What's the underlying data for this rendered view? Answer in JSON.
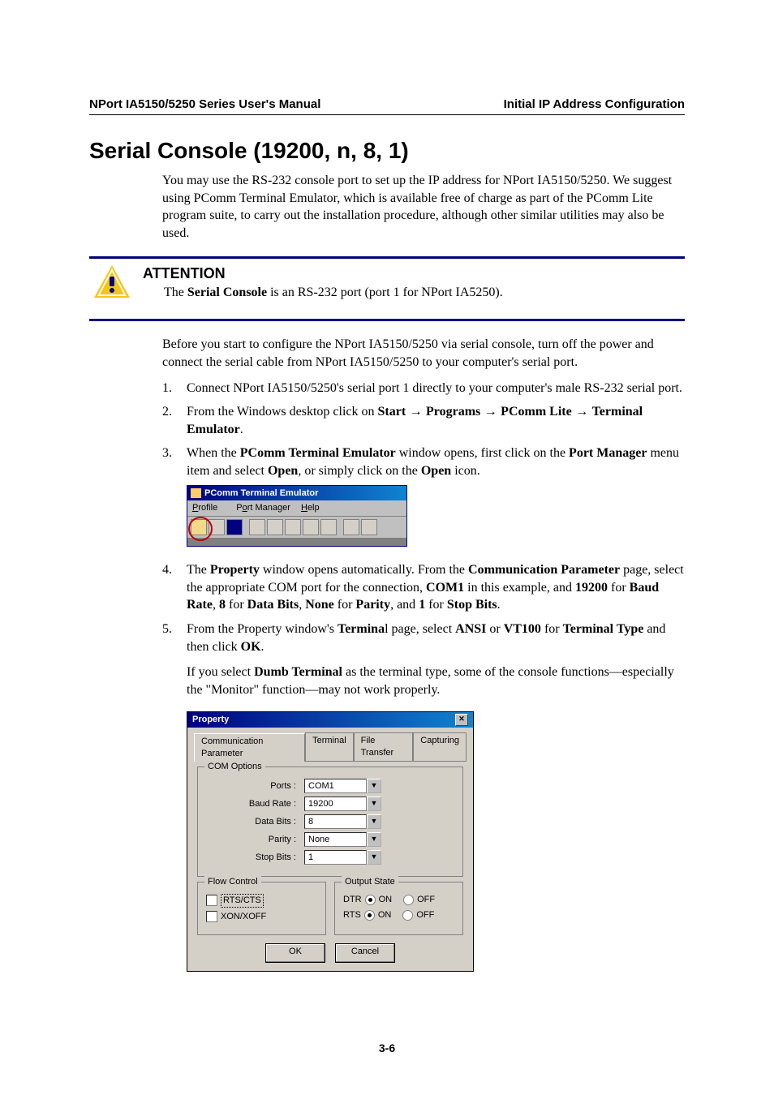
{
  "header": {
    "left": "NPort IA5150/5250 Series User's Manual",
    "right": "Initial IP Address Configuration"
  },
  "section_title": "Serial Console (19200, n, 8, 1)",
  "intro_para": "You may use the RS-232 console port to set up the IP address for NPort IA5150/5250. We suggest using PComm Terminal Emulator, which is available free of charge as part of the PComm Lite program suite, to carry out the installation procedure, although other similar utilities may also be used.",
  "attention": {
    "title": "ATTENTION",
    "text_pre": "The ",
    "text_bold": "Serial Console",
    "text_post": " is an RS-232 port (port 1 for NPort IA5250)."
  },
  "pre_list_para": "Before you start to configure the NPort IA5150/5250 via serial console, turn off the power and connect the serial cable from NPort IA5150/5250 to your computer's serial port.",
  "steps": {
    "s1": "Connect NPort IA5150/5250's serial port 1 directly to your computer's male RS-232 serial port.",
    "s2": {
      "t1": "From the Windows desktop click on ",
      "start": "Start",
      "arrow": " → ",
      "programs": "Programs",
      "pcomm": "PComm Lite",
      "terminal": "Terminal Emulator",
      "period": "."
    },
    "s3": {
      "t1": "When the ",
      "b1": "PComm Terminal Emulator",
      "t2": " window opens, first click on the ",
      "b2": "Port Manager",
      "t3": " menu item and select ",
      "b3": "Open",
      "t4": ", or simply click on the ",
      "b4": "Open",
      "t5": " icon."
    },
    "s4": {
      "t1": "The ",
      "b1": "Property",
      "t2": " window opens automatically. From the ",
      "b2": "Communication Parameter",
      "t3": " page, select the appropriate COM port for the connection, ",
      "b3": "COM1",
      "t4": " in this example, and ",
      "b4": "19200",
      "t5": " for ",
      "b5": "Baud Rate",
      "t6": ", ",
      "b6": "8",
      "t7": " for ",
      "b7": "Data Bits",
      "t8": ", ",
      "b8": "None",
      "t9": " for ",
      "b9": "Parity",
      "t10": ", and ",
      "b10": "1",
      "t11": " for ",
      "b11": "Stop Bits",
      "t12": "."
    },
    "s5": {
      "t1": "From the Property window's ",
      "b1": "Termina",
      "t1b": "l page, select ",
      "b2": "ANSI",
      "t2": " or ",
      "b3": "VT100",
      "t3": " for ",
      "b4": "Terminal Type",
      "t4": " and then click ",
      "b5": "OK",
      "t5": "."
    },
    "s5_sub": {
      "t1": "If you select ",
      "b1": "Dumb Terminal",
      "t2": " as the terminal type, some of the console functions—especially the \"Monitor\" function—may not work properly."
    }
  },
  "pcomm_screenshot": {
    "title": "PComm Terminal Emulator",
    "menu_profile": "Profile",
    "menu_portmanager": "Port Manager",
    "menu_help": "Help"
  },
  "property_dialog": {
    "title": "Property",
    "tabs": {
      "comm": "Communication Parameter",
      "terminal": "Terminal",
      "file": "File Transfer",
      "capturing": "Capturing"
    },
    "com_options_label": "COM Options",
    "ports_label": "Ports :",
    "ports_value": "COM1",
    "baud_label": "Baud Rate :",
    "baud_value": "19200",
    "databits_label": "Data Bits :",
    "databits_value": "8",
    "parity_label": "Parity :",
    "parity_value": "None",
    "stopbits_label": "Stop Bits :",
    "stopbits_value": "1",
    "flow_label": "Flow Control",
    "flow_rtscts": "RTS/CTS",
    "flow_xonxoff": "XON/XOFF",
    "output_label": "Output State",
    "dtr_label": "DTR",
    "rts_label": "RTS",
    "on": "ON",
    "off": "OFF",
    "ok": "OK",
    "cancel": "Cancel"
  },
  "page_number": "3-6"
}
